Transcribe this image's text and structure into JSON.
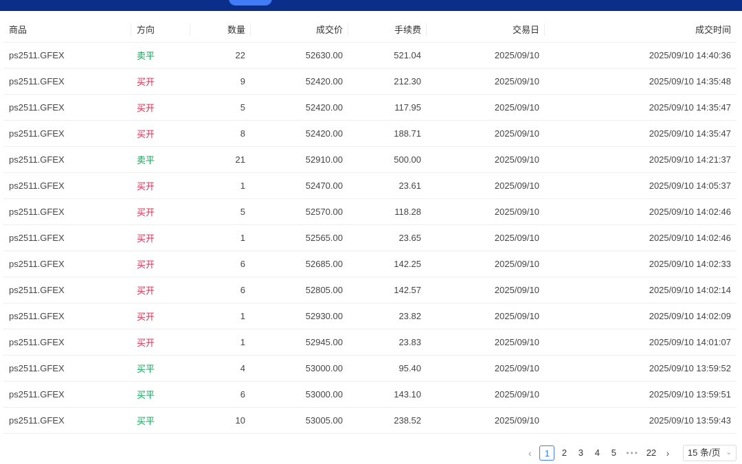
{
  "table": {
    "headers": {
      "product": "商品",
      "direction": "方向",
      "quantity": "数量",
      "price": "成交价",
      "fee": "手续费",
      "trade_date": "交易日",
      "trade_time": "成交时间"
    },
    "rows": [
      {
        "product": "ps2511.GFEX",
        "direction": "卖平",
        "dir_color": "#18a058",
        "quantity": "22",
        "price": "52630.00",
        "fee": "521.04",
        "trade_date": "2025/09/10",
        "trade_time": "2025/09/10 14:40:36"
      },
      {
        "product": "ps2511.GFEX",
        "direction": "买开",
        "dir_color": "#d03050",
        "quantity": "9",
        "price": "52420.00",
        "fee": "212.30",
        "trade_date": "2025/09/10",
        "trade_time": "2025/09/10 14:35:48"
      },
      {
        "product": "ps2511.GFEX",
        "direction": "买开",
        "dir_color": "#d03050",
        "quantity": "5",
        "price": "52420.00",
        "fee": "117.95",
        "trade_date": "2025/09/10",
        "trade_time": "2025/09/10 14:35:47"
      },
      {
        "product": "ps2511.GFEX",
        "direction": "买开",
        "dir_color": "#d03050",
        "quantity": "8",
        "price": "52420.00",
        "fee": "188.71",
        "trade_date": "2025/09/10",
        "trade_time": "2025/09/10 14:35:47"
      },
      {
        "product": "ps2511.GFEX",
        "direction": "卖平",
        "dir_color": "#18a058",
        "quantity": "21",
        "price": "52910.00",
        "fee": "500.00",
        "trade_date": "2025/09/10",
        "trade_time": "2025/09/10 14:21:37"
      },
      {
        "product": "ps2511.GFEX",
        "direction": "买开",
        "dir_color": "#d03050",
        "quantity": "1",
        "price": "52470.00",
        "fee": "23.61",
        "trade_date": "2025/09/10",
        "trade_time": "2025/09/10 14:05:37"
      },
      {
        "product": "ps2511.GFEX",
        "direction": "买开",
        "dir_color": "#d03050",
        "quantity": "5",
        "price": "52570.00",
        "fee": "118.28",
        "trade_date": "2025/09/10",
        "trade_time": "2025/09/10 14:02:46"
      },
      {
        "product": "ps2511.GFEX",
        "direction": "买开",
        "dir_color": "#d03050",
        "quantity": "1",
        "price": "52565.00",
        "fee": "23.65",
        "trade_date": "2025/09/10",
        "trade_time": "2025/09/10 14:02:46"
      },
      {
        "product": "ps2511.GFEX",
        "direction": "买开",
        "dir_color": "#d03050",
        "quantity": "6",
        "price": "52685.00",
        "fee": "142.25",
        "trade_date": "2025/09/10",
        "trade_time": "2025/09/10 14:02:33"
      },
      {
        "product": "ps2511.GFEX",
        "direction": "买开",
        "dir_color": "#d03050",
        "quantity": "6",
        "price": "52805.00",
        "fee": "142.57",
        "trade_date": "2025/09/10",
        "trade_time": "2025/09/10 14:02:14"
      },
      {
        "product": "ps2511.GFEX",
        "direction": "买开",
        "dir_color": "#d03050",
        "quantity": "1",
        "price": "52930.00",
        "fee": "23.82",
        "trade_date": "2025/09/10",
        "trade_time": "2025/09/10 14:02:09"
      },
      {
        "product": "ps2511.GFEX",
        "direction": "买开",
        "dir_color": "#d03050",
        "quantity": "1",
        "price": "52945.00",
        "fee": "23.83",
        "trade_date": "2025/09/10",
        "trade_time": "2025/09/10 14:01:07"
      },
      {
        "product": "ps2511.GFEX",
        "direction": "买平",
        "dir_color": "#18a058",
        "quantity": "4",
        "price": "53000.00",
        "fee": "95.40",
        "trade_date": "2025/09/10",
        "trade_time": "2025/09/10 13:59:52"
      },
      {
        "product": "ps2511.GFEX",
        "direction": "买平",
        "dir_color": "#18a058",
        "quantity": "6",
        "price": "53000.00",
        "fee": "143.10",
        "trade_date": "2025/09/10",
        "trade_time": "2025/09/10 13:59:51"
      },
      {
        "product": "ps2511.GFEX",
        "direction": "买平",
        "dir_color": "#18a058",
        "quantity": "10",
        "price": "53005.00",
        "fee": "238.52",
        "trade_date": "2025/09/10",
        "trade_time": "2025/09/10 13:59:43"
      }
    ]
  },
  "pagination": {
    "prev_icon": "chevron-left-icon",
    "next_icon": "chevron-right-icon",
    "pages": [
      "1",
      "2",
      "3",
      "4",
      "5"
    ],
    "active_page": "1",
    "ellipsis": "•••",
    "last_page": "22",
    "page_size_label": "15 条/页"
  },
  "colors": {
    "topbar": "#0a2e8a",
    "accent": "#3f7cf5",
    "sell_close": "#18a058",
    "buy_open": "#d03050"
  }
}
